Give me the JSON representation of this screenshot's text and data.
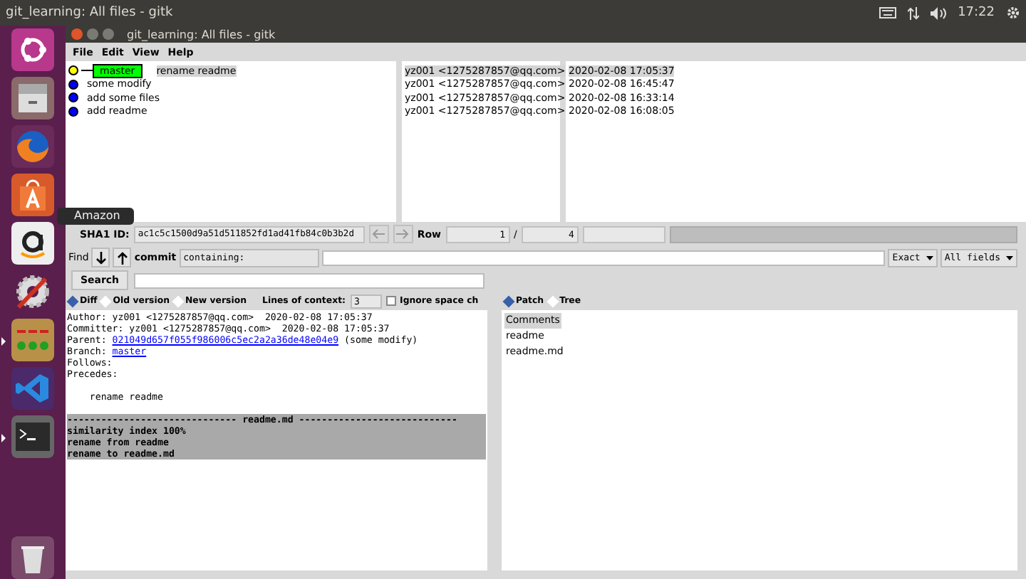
{
  "top_bar": {
    "title": "git_learning: All files - gitk",
    "clock": "17:22"
  },
  "launcher": {
    "items": [
      {
        "kind": "ubuntu",
        "running": false
      },
      {
        "kind": "files",
        "running": false
      },
      {
        "kind": "firefox",
        "running": false
      },
      {
        "kind": "software",
        "running": false
      },
      {
        "kind": "amazon",
        "running": false
      },
      {
        "kind": "settings",
        "running": false
      },
      {
        "kind": "gitk",
        "running": true
      },
      {
        "kind": "vscode",
        "running": false
      },
      {
        "kind": "terminal",
        "running": true
      },
      {
        "kind": "trash",
        "running": false
      }
    ],
    "tooltip": "Amazon"
  },
  "window": {
    "title": "git_learning: All files - gitk",
    "menu": [
      "File",
      "Edit",
      "View",
      "Help"
    ]
  },
  "commits": [
    {
      "subject": "rename readme",
      "branch": "master",
      "author": "yz001 <1275287857@qq.com>",
      "date": "2020-02-08 17:05:37",
      "color": "#ffff00",
      "selected": true
    },
    {
      "subject": "some modify",
      "author": "yz001 <1275287857@qq.com>",
      "date": "2020-02-08 16:45:47",
      "color": "#0000ff",
      "selected": false
    },
    {
      "subject": "add some files",
      "author": "yz001 <1275287857@qq.com>",
      "date": "2020-02-08 16:33:14",
      "color": "#0000ff",
      "selected": false
    },
    {
      "subject": "add readme",
      "author": "yz001 <1275287857@qq.com>",
      "date": "2020-02-08 16:08:05",
      "color": "#0000ff",
      "selected": false
    }
  ],
  "sha1": {
    "label": "SHA1 ID:",
    "value": "ac1c5c1500d9a51d511852fd1ad41fb84c0b3b2d",
    "row_label": "Row",
    "row": "1",
    "separator": "/",
    "total": "4"
  },
  "find": {
    "label": "Find",
    "type": "commit",
    "mode": "containing:",
    "match": "Exact",
    "fields": "All fields",
    "search_button": "Search"
  },
  "diff_options": {
    "views": [
      {
        "label": "Diff",
        "selected": true
      },
      {
        "label": "Old version",
        "selected": false
      },
      {
        "label": "New version",
        "selected": false
      }
    ],
    "context_label": "Lines of context:",
    "context": "3",
    "ignore_space": {
      "label": "Ignore space ch",
      "checked": false
    }
  },
  "file_views": [
    {
      "label": "Patch",
      "selected": true
    },
    {
      "label": "Tree",
      "selected": false
    }
  ],
  "diff_lines": [
    {
      "kind": "plain",
      "text": "Author: yz001 <1275287857@qq.com>  2020-02-08 17:05:37"
    },
    {
      "kind": "plain",
      "text": "Committer: yz001 <1275287857@qq.com>  2020-02-08 17:05:37"
    },
    {
      "kind": "link",
      "prefix": "Parent: ",
      "link": "021049d657f055f986006c5ec2a2a36de48e04e9",
      "suffix": " (some modify)"
    },
    {
      "kind": "link",
      "prefix": "Branch: ",
      "link": "master"
    },
    {
      "kind": "plain",
      "text": "Follows:"
    },
    {
      "kind": "plain",
      "text": "Precedes:"
    },
    {
      "kind": "blank"
    },
    {
      "kind": "plain",
      "text": "    rename readme"
    },
    {
      "kind": "blank"
    },
    {
      "kind": "file_header",
      "text": "------------------------------ readme.md ----------------------------"
    },
    {
      "kind": "meta",
      "text": "similarity index 100%"
    },
    {
      "kind": "meta",
      "text": "rename from readme"
    },
    {
      "kind": "meta",
      "text": "rename to readme.md"
    }
  ],
  "files": [
    {
      "name": "Comments",
      "selected": true
    },
    {
      "name": "readme",
      "selected": false
    },
    {
      "name": "readme.md",
      "selected": false
    }
  ]
}
